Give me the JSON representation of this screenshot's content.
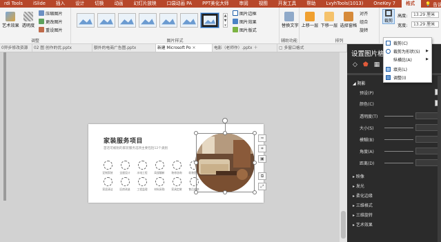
{
  "menubar": {
    "items": [
      "rdi Tools",
      "iSlide",
      "插入",
      "设计",
      "切换",
      "动画",
      "幻灯片放映",
      "口袋动画 PA",
      "PPT美化大师",
      "审阅",
      "视图",
      "开发工具",
      "帮助",
      "LvyhTools(1013)",
      "OneKey 7",
      "格式"
    ],
    "active_index": 15,
    "tell": "告诉我"
  },
  "ribbon": {
    "adjust": {
      "art": "艺术效果",
      "transparency": "透明度",
      "compress": "压缩图片",
      "change": "更改图片",
      "reset": "重设图片",
      "label": "调整"
    },
    "styles": {
      "border": "图片边框",
      "effects": "图片效果",
      "layout": "图片版式",
      "label": "图片样式"
    },
    "access": {
      "alt": "替换文字",
      "label": "辅助功能"
    },
    "arrange": {
      "forward": "上移一层",
      "backward": "下移一层",
      "pane": "选择窗格",
      "align": "对齐",
      "group": "组合",
      "rotate": "旋转",
      "label": "排列"
    },
    "size": {
      "crop": "裁剪",
      "height_label": "高度:",
      "height": "13.29 厘米",
      "width_label": "宽度:",
      "width": "13.29 厘米"
    }
  },
  "tabs": [
    {
      "label": "0异步修改资源"
    },
    {
      "label": "02 图 创作的优.pptx"
    },
    {
      "label": "额外的电商广告图.pptx"
    },
    {
      "label": "新建 Microsoft Po"
    },
    {
      "label": "电影（老师作）.pptx"
    },
    {
      "label": "多窗口格式"
    }
  ],
  "active_tab": 3,
  "slide": {
    "title": "家装服务项目",
    "subtitle": "首话可被削的家装服务选项主要包括12个类别",
    "icons": [
      "定制家装",
      "全屋设计",
      "水电工程",
      "局部翻新",
      "装修咨询",
      "软装搭配",
      "家居清洁",
      "旧房改造",
      "工程监理",
      "材料采购",
      "家具定做",
      "售后维修"
    ]
  },
  "pane": {
    "title": "设置图片格式",
    "sections": {
      "shadow": "阴影",
      "reflection": "映像",
      "glow": "发光",
      "soft_edges": "柔化边缘",
      "bevel": "三维格式",
      "rotation": "三维旋转",
      "artistic": "艺术效果"
    },
    "shadow_rows": {
      "preset": "预设(P)",
      "color": "颜色(C)",
      "transparency": "透明度(T)",
      "size": "大小(S)",
      "blur": "模糊(B)",
      "angle": "角度(A)",
      "distance": "距离(D)"
    }
  },
  "dropdown": {
    "items": [
      "裁剪(C)",
      "裁剪为形状(S)",
      "纵横比(A)",
      "填充(L)",
      "调整(I)"
    ]
  }
}
